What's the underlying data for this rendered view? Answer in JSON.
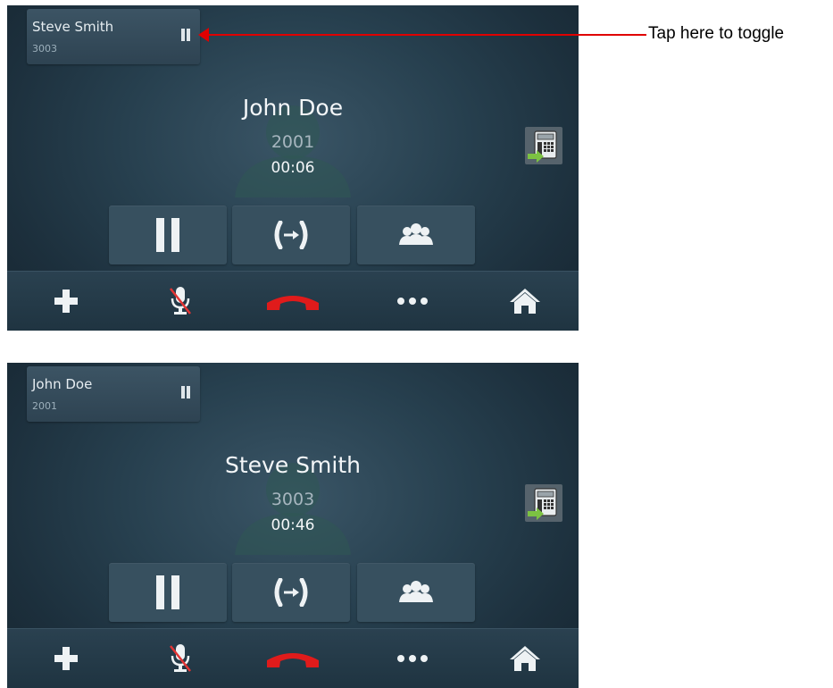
{
  "colors": {
    "end_call": "#e01b1b",
    "transfer_arrow": "#7cc242",
    "mute_slash": "#e23434",
    "annotation": "#e00000"
  },
  "annotation": {
    "text": "Tap here to toggle"
  },
  "screens": [
    {
      "held_call": {
        "name": "Steve Smith",
        "extension": "3003",
        "icon": "pause-icon"
      },
      "active_call": {
        "name": "John Doe",
        "extension": "2001",
        "duration": "00:06"
      }
    },
    {
      "held_call": {
        "name": "John Doe",
        "extension": "2001",
        "icon": "pause-icon"
      },
      "active_call": {
        "name": "Steve Smith",
        "extension": "3003",
        "duration": "00:46"
      }
    }
  ],
  "action_buttons": [
    "hold-icon",
    "transfer-icon",
    "conference-icon"
  ],
  "bottom_bar": [
    "add-call-icon",
    "mute-icon",
    "end-call-icon",
    "more-icon",
    "home-icon"
  ]
}
